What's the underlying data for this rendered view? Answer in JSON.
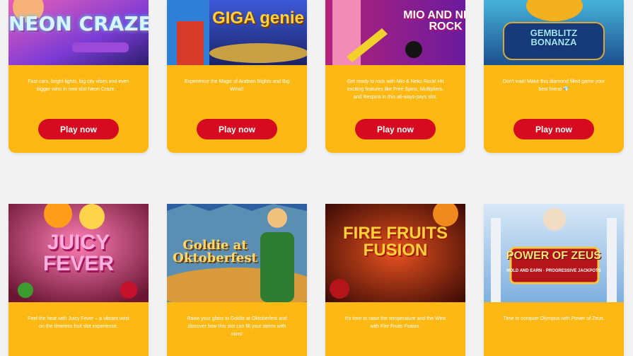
{
  "games_row1": [
    {
      "title": "NEON CRAZE",
      "desc": "Fast cars, bright lights, big city vibes and even bigger wins in new slot Neon Craze🤘",
      "cta": "Play now"
    },
    {
      "title": "GIGA genie",
      "desc": "Experience the Magic of Arabian Nights and Big Wins!!",
      "cta": "Play now"
    },
    {
      "title": "MIO AND NEKO ROCK",
      "desc": "Get ready to rock with Mio & Neko Rock! Hit exciting features like Free Spins, Multipliers, and Respins in this all-ways-pays slot.",
      "cta": "Play now"
    },
    {
      "title": "GEMBLITZ BONANZA",
      "desc": "Don't wait! Make this diamond filled game your best friend 💎",
      "cta": "Play now"
    }
  ],
  "games_row2": [
    {
      "title": "JUICY FEVER",
      "desc": "Feel the heat with Juicy Fever – a vibrant twist on the timeless fruit slot experience."
    },
    {
      "title": "Goldie at Oktoberfest",
      "desc": "Raise your glass to Goldie at Oktoberfest and discover how this slot can fill your steins with wins!"
    },
    {
      "title": "FIRE FRUITS FUSION",
      "desc": "It's time to raise the temperature and the Wins with Fire Fruits Fusion."
    },
    {
      "title": "POWER OF ZEUS",
      "subtitle": "HOLD AND EARN · PROGRESSIVE JACKPOTS",
      "desc": "Time to conquer Olympus with Power of Zeus."
    }
  ],
  "colors": {
    "card": "#fdb813",
    "button": "#d60b1f",
    "page": "#f2f2f3"
  }
}
